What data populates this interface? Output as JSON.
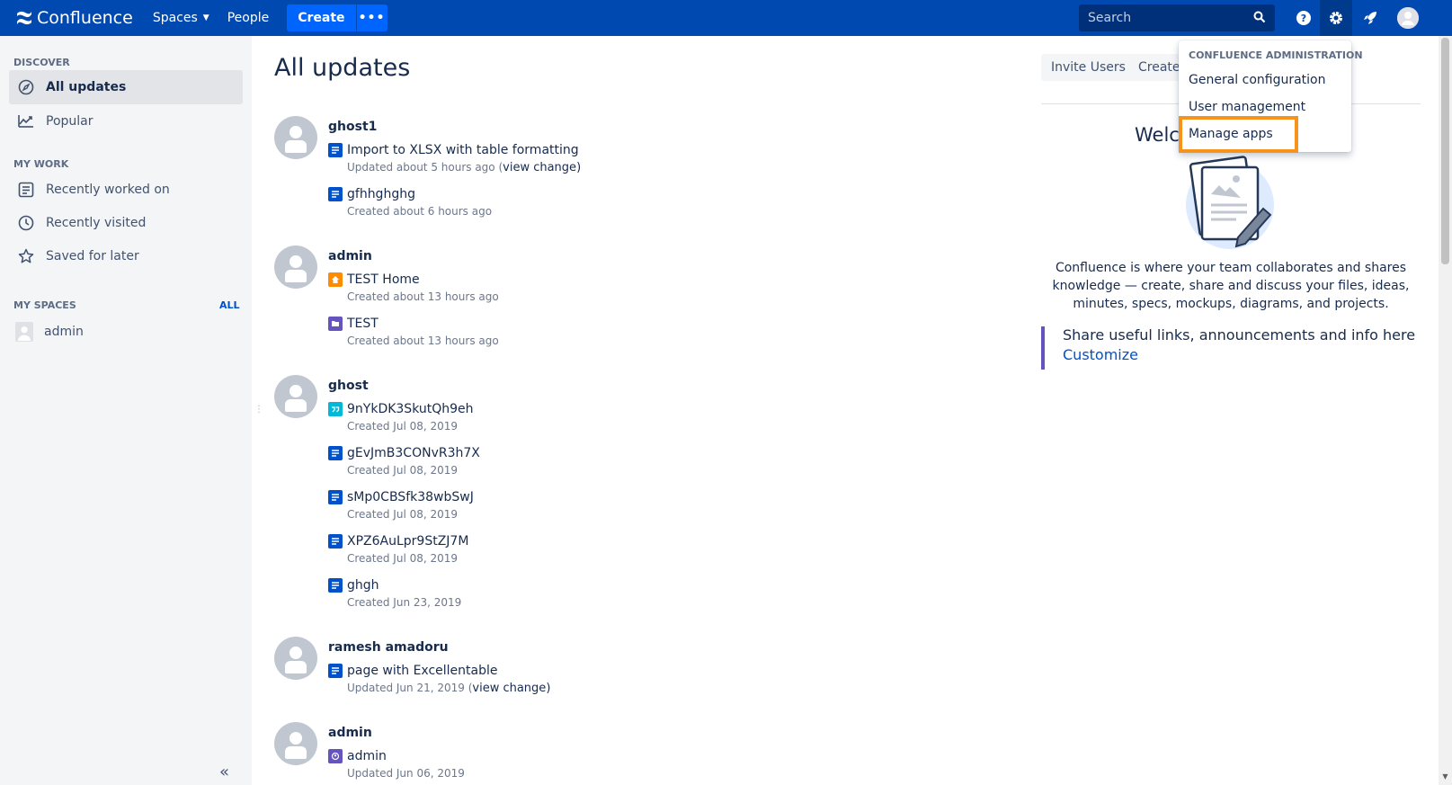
{
  "topnav": {
    "logo": "Confluence",
    "spaces": "Spaces",
    "people": "People",
    "create": "Create",
    "search_placeholder": "Search"
  },
  "sidebar": {
    "discover_heading": "DISCOVER",
    "all_updates": "All updates",
    "popular": "Popular",
    "mywork_heading": "MY WORK",
    "recently_worked": "Recently worked on",
    "recently_visited": "Recently visited",
    "saved_later": "Saved for later",
    "myspaces_heading": "MY SPACES",
    "all_link": "ALL",
    "space_admin": "admin"
  },
  "main": {
    "title": "All updates",
    "groups": [
      {
        "user": "ghost1",
        "entries": [
          {
            "title": "Import to XLSX with table formatting",
            "meta": "Updated about 5 hours ago (",
            "link": "view change",
            "after": ")"
          },
          {
            "title": "gfhhghghg",
            "meta": "Created about 6 hours ago"
          }
        ]
      },
      {
        "user": "admin",
        "entries": [
          {
            "title": "TEST Home",
            "meta": "Created about 13 hours ago"
          },
          {
            "title": "TEST",
            "meta": "Created about 13 hours ago"
          }
        ]
      },
      {
        "user": "ghost",
        "entries": [
          {
            "title": "9nYkDK3SkutQh9eh",
            "meta": "Created Jul 08, 2019"
          },
          {
            "title": "gEvJmB3CONvR3h7X",
            "meta": "Created Jul 08, 2019"
          },
          {
            "title": "sMp0CBSfk38wbSwJ",
            "meta": "Created Jul 08, 2019"
          },
          {
            "title": "XPZ6AuLpr9StZJ7M",
            "meta": "Created Jul 08, 2019"
          },
          {
            "title": "ghgh",
            "meta": "Created Jun 23, 2019"
          }
        ]
      },
      {
        "user": "ramesh amadoru",
        "entries": [
          {
            "title": "page with Excellentable",
            "meta": "Updated Jun 21, 2019 (",
            "link": "view change",
            "after": ")"
          }
        ]
      },
      {
        "user": "admin",
        "entries": [
          {
            "title": "admin",
            "meta": "Updated Jun 06, 2019"
          }
        ]
      }
    ]
  },
  "right": {
    "invite_users": "Invite Users",
    "create_btn": "Create",
    "welcome_partial": "Welc",
    "welcome_text": "Confluence is where your team collaborates and shares knowledge — create, share and discuss your files, ideas, minutes, specs, mockups, diagrams, and projects.",
    "share_text": "Share useful links, announcements and info here",
    "customize": "Customize"
  },
  "dropdown": {
    "heading": "CONFLUENCE ADMINISTRATION",
    "general": "General configuration",
    "users": "User management",
    "apps": "Manage apps"
  },
  "colors": {
    "nav_bg": "#0049b0",
    "create_bg": "#0065ff",
    "highlight": "#f5931d",
    "accent_bar": "#6554c0"
  }
}
